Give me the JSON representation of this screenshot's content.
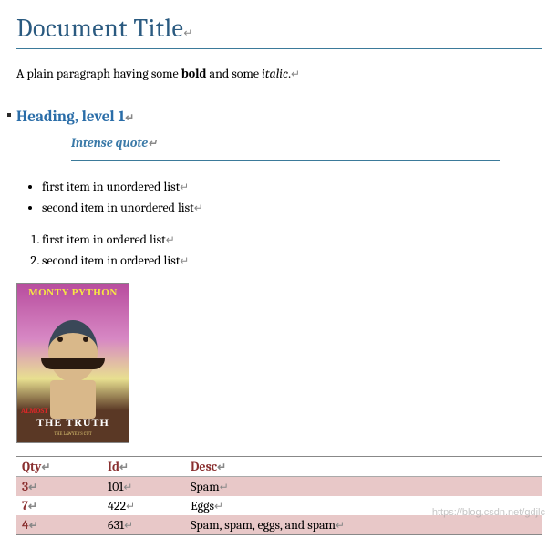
{
  "title": "Document Title",
  "paragraph": {
    "pre": "A plain paragraph having some ",
    "bold": "bold",
    "mid": " and some ",
    "italic": "italic",
    "post": "."
  },
  "heading1": "Heading, level 1",
  "quote": "Intense quote",
  "ulist": {
    "items": [
      "first item in unordered list",
      "second item in unordered list"
    ]
  },
  "olist": {
    "items": [
      "first item in ordered list",
      "second item in ordered list"
    ]
  },
  "image": {
    "top_text": "MONTY PYTHON",
    "almost": "ALMOST",
    "truth": "THE TRUTH",
    "sub": "THE LAWYER'S CUT"
  },
  "table": {
    "headers": [
      "Qty",
      "Id",
      "Desc"
    ],
    "rows": [
      {
        "qty": "3",
        "id": "101",
        "desc": "Spam"
      },
      {
        "qty": "7",
        "id": "422",
        "desc": "Eggs"
      },
      {
        "qty": "4",
        "id": "631",
        "desc": "Spam, spam, eggs, and spam"
      }
    ]
  },
  "pilcrow": "↵",
  "watermark": "https://blog.csdn.net/gdjlc"
}
